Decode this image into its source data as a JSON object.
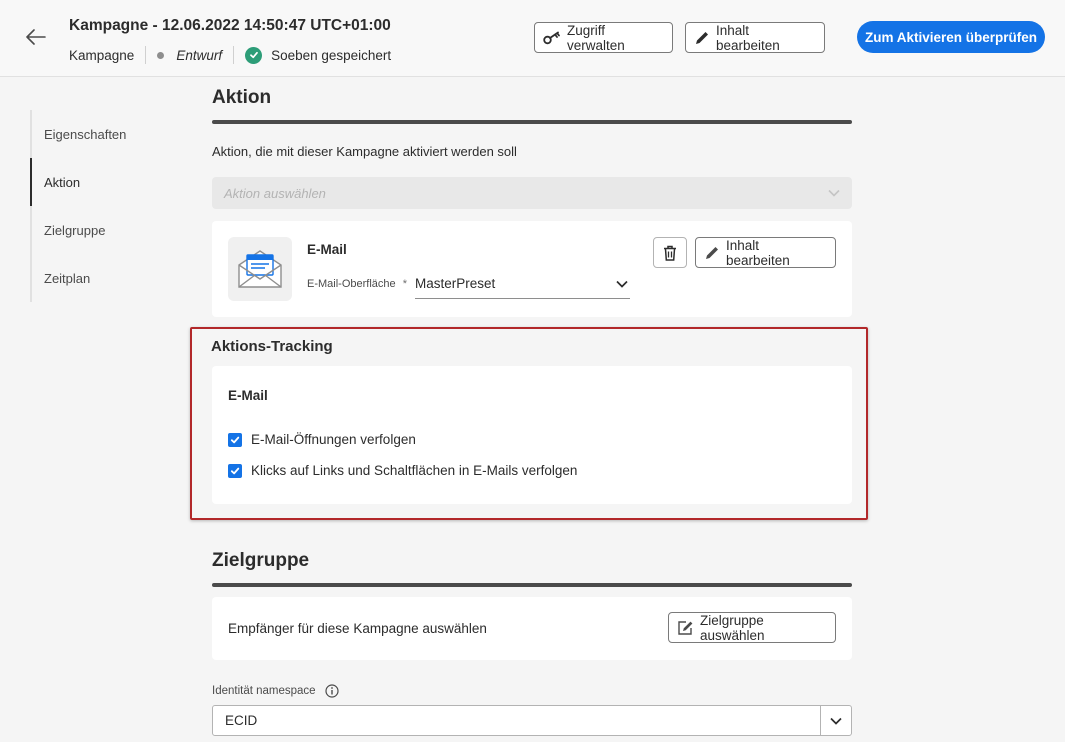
{
  "header": {
    "title": "Kampagne - 12.06.2022 14:50:47 UTC+01:00",
    "type_label": "Kampagne",
    "status": "Entwurf",
    "saved_text": "Soeben gespeichert",
    "manage_access_label": "Zugriff verwalten",
    "edit_content_label": "Inhalt bearbeiten",
    "review_activate_label": "Zum Aktivieren überprüfen"
  },
  "nav": {
    "items": [
      {
        "label": "Eigenschaften"
      },
      {
        "label": "Aktion"
      },
      {
        "label": "Zielgruppe"
      },
      {
        "label": "Zeitplan"
      }
    ]
  },
  "action_section": {
    "title": "Aktion",
    "description": "Aktion, die mit dieser Kampagne aktiviert werden soll",
    "select_placeholder": "Aktion auswählen",
    "email_card": {
      "title": "E-Mail",
      "surface_label": "E-Mail-Oberfläche",
      "required_mark": "*",
      "surface_value": "MasterPreset",
      "edit_content_label": "Inhalt bearbeiten"
    }
  },
  "tracking_section": {
    "title": "Aktions-Tracking",
    "card_title": "E-Mail",
    "options": [
      {
        "label": "E-Mail-Öffnungen verfolgen",
        "checked": true
      },
      {
        "label": "Klicks auf Links und Schaltflächen in E-Mails verfolgen",
        "checked": true
      }
    ]
  },
  "audience_section": {
    "title": "Zielgruppe",
    "description": "Empfänger für diese Kampagne auswählen",
    "select_audience_label": "Zielgruppe auswählen",
    "identity_label": "Identität namespace",
    "identity_value": "ECID"
  },
  "colors": {
    "accent": "#1473e6",
    "success": "#2d9d78",
    "highlight_border": "#b2282a"
  }
}
